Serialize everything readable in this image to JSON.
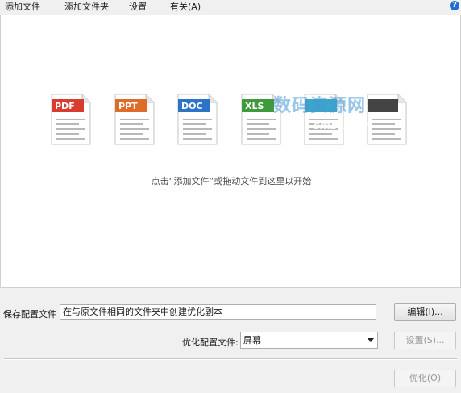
{
  "menu": {
    "add_file": "添加文件",
    "add_folder": "添加文件夹",
    "settings": "设置",
    "about": "有关(A)",
    "help_glyph": "?"
  },
  "file_types": [
    {
      "label": "PDF",
      "color": "#d83b2f",
      "name": "pdf-file-icon"
    },
    {
      "label": "PPT",
      "color": "#e06c2a",
      "name": "ppt-file-icon"
    },
    {
      "label": "DOC",
      "color": "#2b74c8",
      "name": "doc-file-icon"
    },
    {
      "label": "XLS",
      "color": "#3f9a3c",
      "name": "xls-file-icon"
    },
    {
      "label": "",
      "color": "#3aa6c9",
      "name": "image-file-icon"
    },
    {
      "label": "",
      "color": "#444444",
      "name": "zip-file-icon"
    }
  ],
  "drop_hint": "点击“添加文件”或拖动文件到这里以开始",
  "watermark": {
    "text": "数码资源网",
    "sub": "smzy.com"
  },
  "save": {
    "label": "保存配置文件",
    "value": "在与原文件相同的文件夹中创建优化副本",
    "edit_button": "编辑(I)..."
  },
  "optimize": {
    "label": "优化配置文件:",
    "selected": "屏幕",
    "settings_button": "设置(S)...",
    "run_button": "优化(O)"
  }
}
